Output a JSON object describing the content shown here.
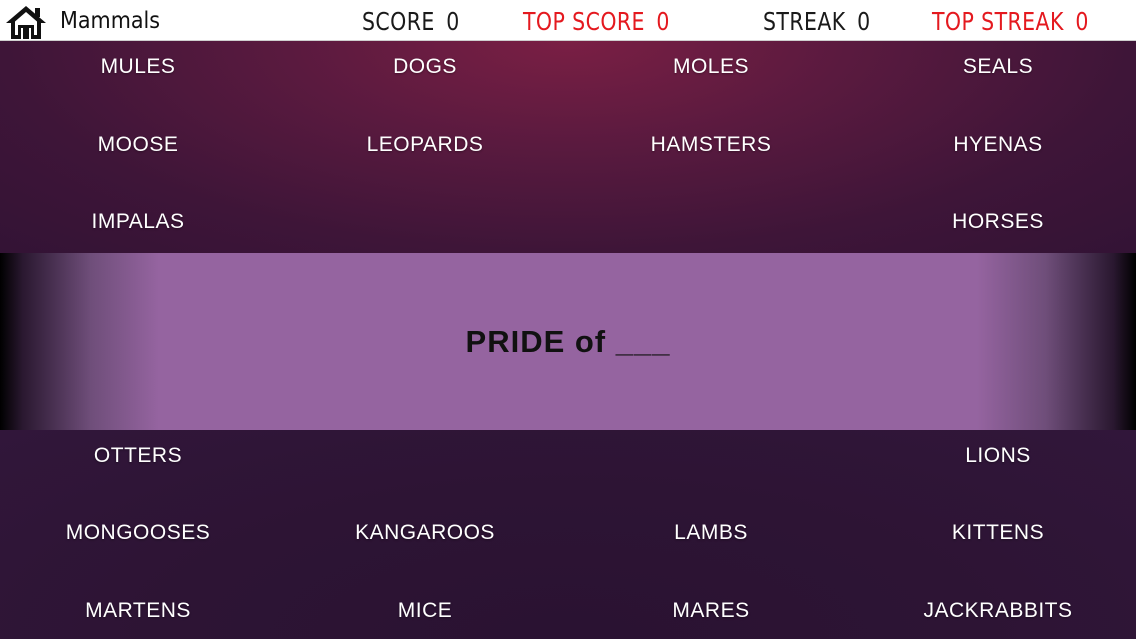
{
  "header": {
    "category": "Mammals",
    "score_label": "SCORE",
    "score_value": "0",
    "top_score_label": "TOP SCORE",
    "top_score_value": "0",
    "streak_label": "STREAK",
    "streak_value": "0",
    "top_streak_label": "TOP STREAK",
    "top_streak_value": "0"
  },
  "question": "PRIDE of ___",
  "words_top": [
    [
      "MULES",
      "DOGS",
      "MOLES",
      "SEALS"
    ],
    [
      "MOOSE",
      "LEOPARDS",
      "HAMSTERS",
      "HYENAS"
    ],
    [
      "IMPALAS",
      "",
      "",
      "HORSES"
    ]
  ],
  "words_bottom": [
    [
      "OTTERS",
      "",
      "",
      "LIONS"
    ],
    [
      "MONGOOSES",
      "KANGAROOS",
      "LAMBS",
      "KITTENS"
    ],
    [
      "MARTENS",
      "MICE",
      "MARES",
      "JACKRABBITS"
    ]
  ],
  "icons": {
    "home": "home-icon"
  },
  "colors": {
    "accent_red": "#e4191f",
    "band": "#9564a0",
    "background": "#3e1538"
  }
}
